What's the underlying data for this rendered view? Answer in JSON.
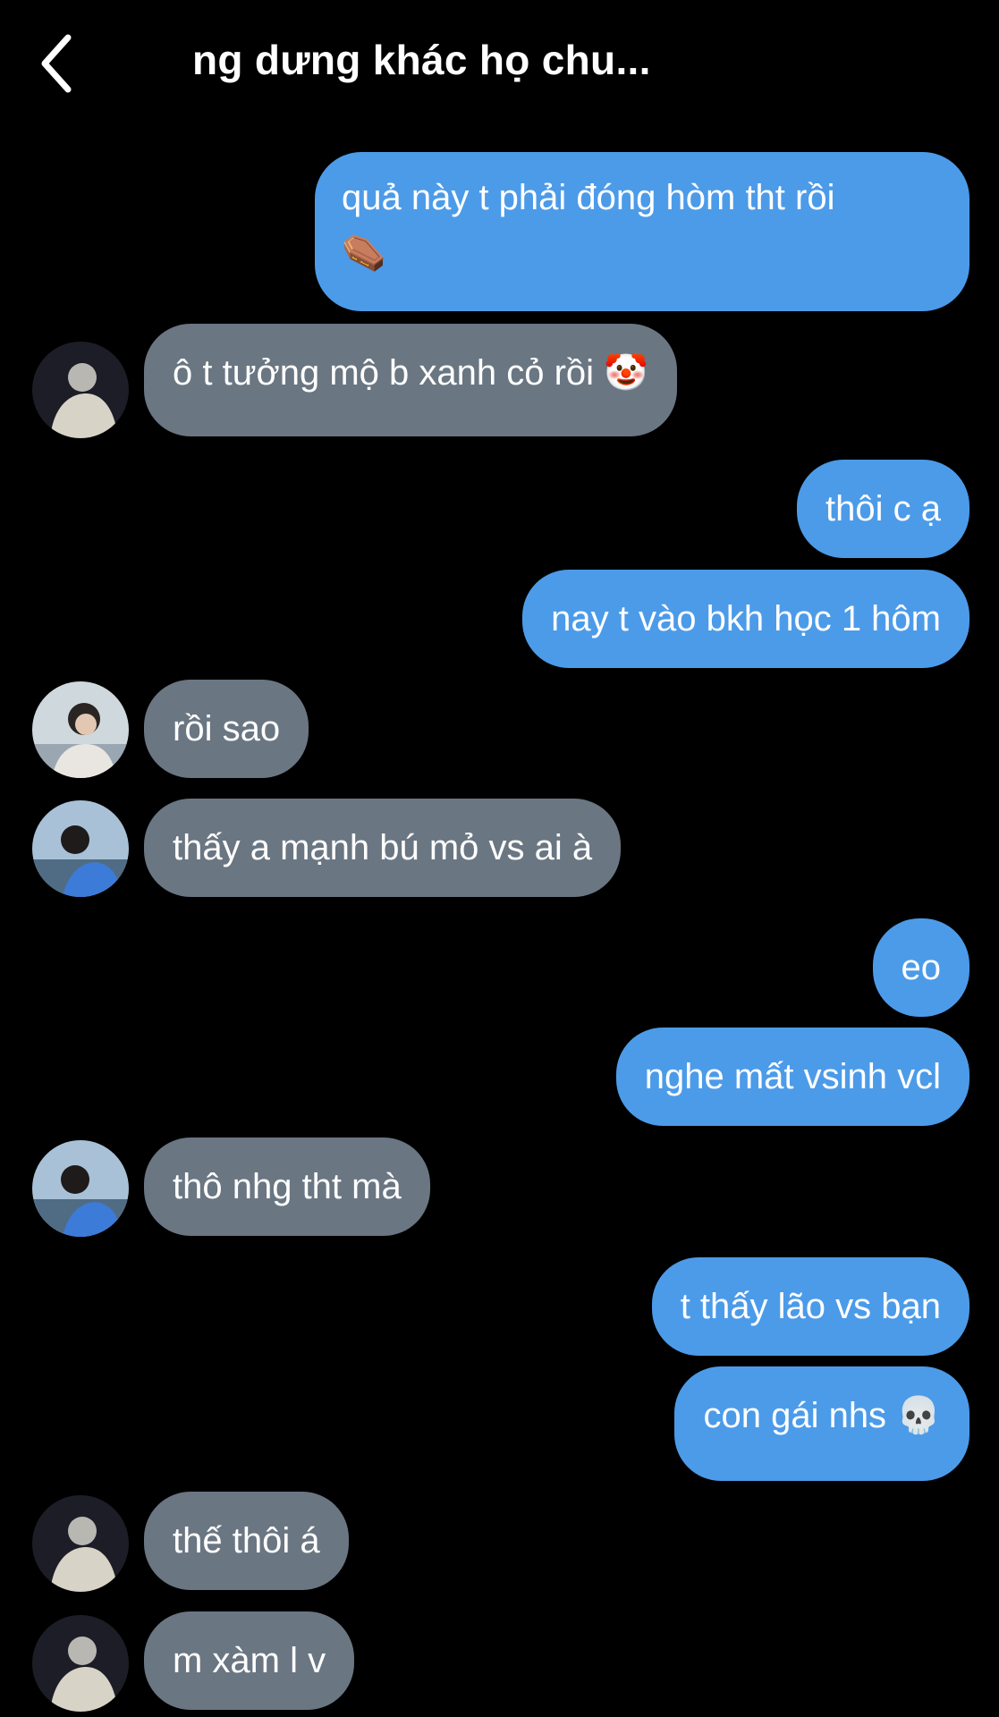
{
  "header": {
    "back_icon": "chevron-left-icon",
    "title": "ng dưng khác họ chu..."
  },
  "colors": {
    "background": "#000000",
    "outgoing_bubble": "#4C9BE9",
    "incoming_bubble": "#6A7682",
    "text": "#FFFFFF"
  },
  "messages": [
    {
      "direction": "outgoing",
      "text": "quả này t phải đóng hòm tht rồi",
      "emoji": "⚰️",
      "emoji_icon": "coffin-emoji"
    },
    {
      "direction": "incoming",
      "text": "ô t tưởng mộ b xanh cỏ rồi",
      "emoji": "🤡",
      "emoji_icon": "clown-emoji",
      "avatar": "avatar-light-hair"
    },
    {
      "direction": "outgoing",
      "text": "thôi c ạ"
    },
    {
      "direction": "outgoing",
      "text": "nay t vào bkh học 1 hôm"
    },
    {
      "direction": "incoming",
      "text": "rồi sao",
      "avatar": "avatar-dark-hair"
    },
    {
      "direction": "incoming",
      "text": "thấy a mạnh bú mỏ vs ai à",
      "avatar": "avatar-blue-jacket"
    },
    {
      "direction": "outgoing",
      "text": "eo"
    },
    {
      "direction": "outgoing",
      "text": "nghe mất vsinh vcl"
    },
    {
      "direction": "incoming",
      "text": "thô nhg tht mà",
      "avatar": "avatar-blue-jacket"
    },
    {
      "direction": "outgoing",
      "text": "t thấy lão vs bạn"
    },
    {
      "direction": "outgoing",
      "text": "con gái nhs",
      "emoji": "💀",
      "emoji_icon": "skull-emoji"
    },
    {
      "direction": "incoming",
      "text": "thế thôi á",
      "avatar": "avatar-light-hair"
    },
    {
      "direction": "incoming",
      "text": "m xàm l v",
      "avatar": "avatar-light-hair"
    }
  ]
}
